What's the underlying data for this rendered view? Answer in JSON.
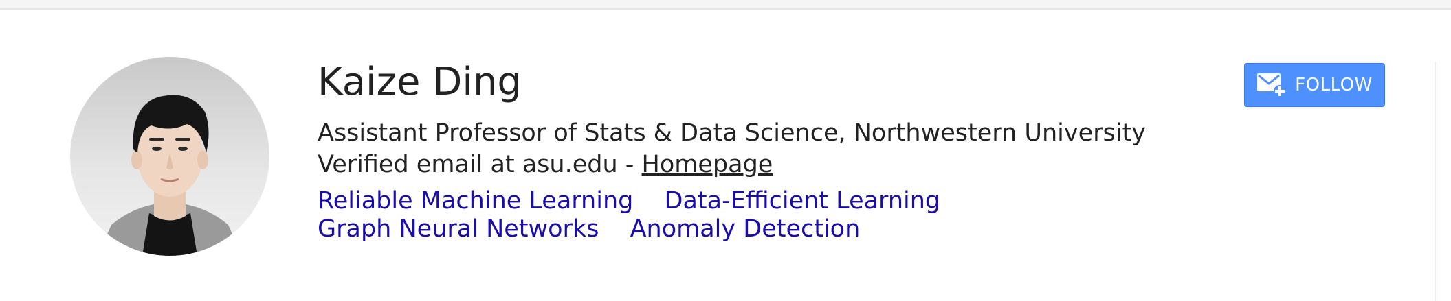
{
  "profile": {
    "name": "Kaize Ding",
    "affiliation": "Assistant Professor of Stats & Data Science, Northwestern University",
    "email_prefix": "Verified email at asu.edu - ",
    "homepage_label": "Homepage",
    "interests": [
      "Reliable Machine Learning",
      "Data-Efficient Learning",
      "Graph Neural Networks",
      "Anomaly Detection"
    ]
  },
  "actions": {
    "follow_label": "FOLLOW",
    "follow_icon": "email-add-icon"
  },
  "colors": {
    "interest_link": "#1a0dab",
    "follow_button": "#4d90fe",
    "text": "#222222"
  }
}
